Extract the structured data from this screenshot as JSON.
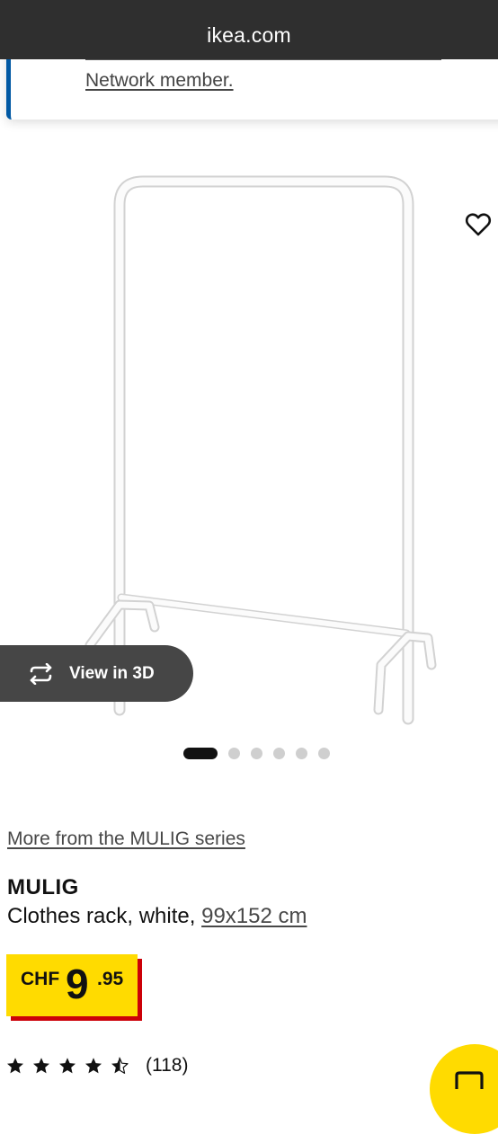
{
  "browser": {
    "domain": "ikea.com"
  },
  "notice": {
    "link_text": "Network member."
  },
  "gallery": {
    "favorite_icon": "heart-outline-icon",
    "view_3d": {
      "label": "View in 3D",
      "icon": "rotate-3d-icon"
    },
    "dots": {
      "count": 6,
      "active_index": 0
    }
  },
  "product": {
    "series_link": "More from the MULIG series",
    "name": "MULIG",
    "description_prefix": "Clothes rack, white, ",
    "size_link": "99x152 cm"
  },
  "price": {
    "currency": "CHF",
    "integer": "9",
    "decimal": ".95"
  },
  "rating": {
    "stars": 4.5,
    "max_stars": 5,
    "count_text": "(118)"
  },
  "colors": {
    "browser_bar": "#2f2f2f",
    "ikea_blue": "#0058a3",
    "ikea_yellow": "#ffdb00",
    "price_red": "#cc0008",
    "view3d_bg": "#464646"
  }
}
